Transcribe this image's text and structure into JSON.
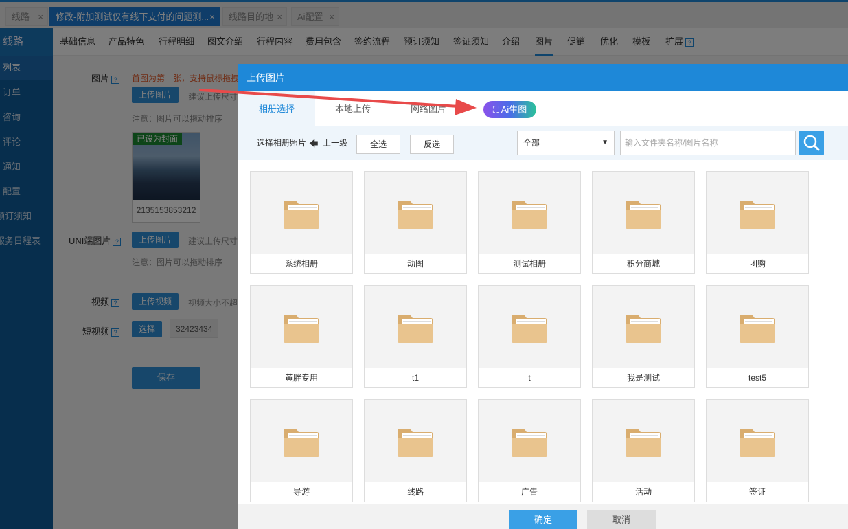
{
  "top_tabs": [
    {
      "label": "线路",
      "close": "×"
    },
    {
      "label": "修改-附加测试仅有线下支付的问题测...",
      "close": "×"
    },
    {
      "label": "线路目的地",
      "close": "×"
    },
    {
      "label": "Ai配置",
      "close": "×"
    }
  ],
  "sidebar": {
    "title": "线路",
    "items": [
      "列表",
      "订单",
      "咨询",
      "评论",
      "通知",
      "配置",
      "预订须知",
      "服务日程表"
    ]
  },
  "subnav": {
    "items": [
      "基础信息",
      "产品特色",
      "行程明细",
      "图文介绍",
      "行程内容",
      "费用包含",
      "签约流程",
      "预订须知",
      "签证须知",
      "介绍",
      "图片",
      "促销",
      "优化",
      "模板",
      "扩展"
    ],
    "help_mark": "?"
  },
  "form": {
    "image_label": "图片",
    "image_hint_red": "首图为第一张，支持鼠标拖拽",
    "upload_image": "上传图片",
    "size_hint": "建议上传尺寸",
    "drag_note": "注意：图片可以拖动排序",
    "cover_badge": "已设为封面",
    "thumb_name": "2135153853212",
    "uni_label": "UNI端图片",
    "uni_upload": "上传图片",
    "uni_size_hint": "建议上传尺寸",
    "uni_drag_note": "注意：图片可以拖动排序",
    "video_label": "视频",
    "upload_video": "上传视频",
    "video_hint": "视频大小不超",
    "short_video_label": "短视频",
    "choose": "选择",
    "short_video_tag": "32423434",
    "save": "保存"
  },
  "modal": {
    "title": "上传图片",
    "tabs": [
      "相册选择",
      "本地上传",
      "网络图片"
    ],
    "ai_button": "Ai生图",
    "toolbar": {
      "select_label": "选择相册照片",
      "back": "上一级",
      "select_all": "全选",
      "invert": "反选",
      "filter_value": "全部",
      "search_placeholder": "输入文件夹名称/图片名称"
    },
    "folders": [
      "系统相册",
      "动图",
      "测试相册",
      "积分商城",
      "团购",
      "黄胖专用",
      "t1",
      "t",
      "我是测试",
      "test5",
      "导游",
      "线路",
      "广告",
      "活动",
      "签证"
    ],
    "ok": "确定",
    "cancel": "取消"
  },
  "colors": {
    "primary": "#1e88d8",
    "sidebar_bg": "#0e5d9a",
    "annotation_arrow": "#e84a4a",
    "folder": "#e9c48e"
  }
}
